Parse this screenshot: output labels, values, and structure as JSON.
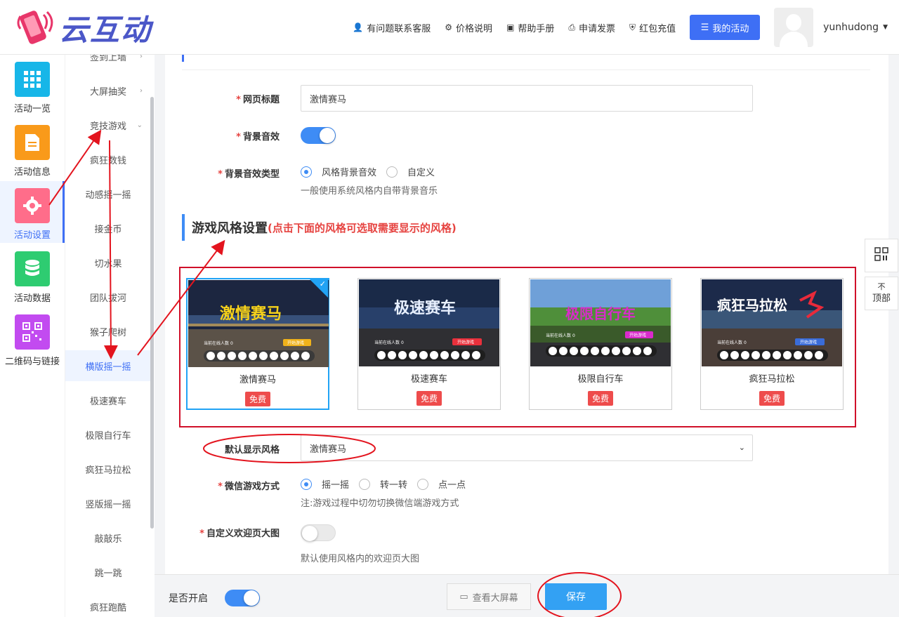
{
  "header": {
    "logo_text": "云互动",
    "nav": [
      {
        "label": "有问题联系客服",
        "icon": "user-plus-icon"
      },
      {
        "label": "价格说明",
        "icon": "gear-icon"
      },
      {
        "label": "帮助手册",
        "icon": "book-icon"
      },
      {
        "label": "申请发票",
        "icon": "printer-icon"
      },
      {
        "label": "红包充值",
        "icon": "shield-check-icon"
      }
    ],
    "my_activity": "我的活动",
    "username": "yunhudong"
  },
  "sidebar": [
    {
      "label": "活动一览",
      "color": "#17b6e8",
      "icon": "grid-icon"
    },
    {
      "label": "活动信息",
      "color": "#f99a1a",
      "icon": "document-icon"
    },
    {
      "label": "活动设置",
      "color": "#ff6d8a",
      "icon": "gear-icon"
    },
    {
      "label": "活动数据",
      "color": "#2ecc71",
      "icon": "database-icon"
    },
    {
      "label": "二维码与链接",
      "color": "#c24bf0",
      "icon": "qrcode-icon"
    }
  ],
  "submenu": [
    "签到上墙",
    "大屏抽奖",
    "竞技游戏",
    "疯狂数钱",
    "动感摇一摇",
    "接金币",
    "切水果",
    "团队拔河",
    "猴子爬树",
    "横版摇一摇",
    "极速赛车",
    "极限自行车",
    "疯狂马拉松",
    "竖版摇一摇",
    "敲敲乐",
    "跳一跳",
    "疯狂跑酷"
  ],
  "form": {
    "page_title_label": "网页标题",
    "page_title_value": "激情赛马",
    "bg_music_label": "背景音效",
    "bg_music_type_label": "背景音效类型",
    "bg_music_options": [
      "风格背景音效",
      "自定义"
    ],
    "bg_music_hint": "一般使用系统风格内自带背景音乐",
    "style_section_title": "游戏风格设置",
    "style_section_note": "(点击下面的风格可选取需要显示的风格)",
    "styles": [
      {
        "name": "激情赛马",
        "tag": "免费",
        "thumb_title": "激情赛马",
        "button": "开始游戏"
      },
      {
        "name": "极速赛车",
        "tag": "免费",
        "thumb_title": "极速赛车",
        "button": "开始游戏"
      },
      {
        "name": "极限自行车",
        "tag": "免费",
        "thumb_title": "极限自行车",
        "button": "开始游戏"
      },
      {
        "name": "疯狂马拉松",
        "tag": "免费",
        "thumb_title": "疯狂马拉松",
        "button": "开始游戏"
      }
    ],
    "thumb_online": "当前在线人数",
    "thumb_count": "0",
    "default_style_label": "默认显示风格",
    "default_style_value": "激情赛马",
    "wechat_mode_label": "微信游戏方式",
    "wechat_mode_options": [
      "摇一摇",
      "转一转",
      "点一点"
    ],
    "wechat_mode_hint": "注:游戏过程中切勿切换微信端游戏方式",
    "welcome_label": "自定义欢迎页大图",
    "welcome_hint": "默认使用风格内的欢迎页大图"
  },
  "footer": {
    "enable_label": "是否开启",
    "view_screen": "查看大屏幕",
    "save": "保存"
  },
  "float": {
    "top_label": "顶部",
    "top_arrow": "不"
  }
}
